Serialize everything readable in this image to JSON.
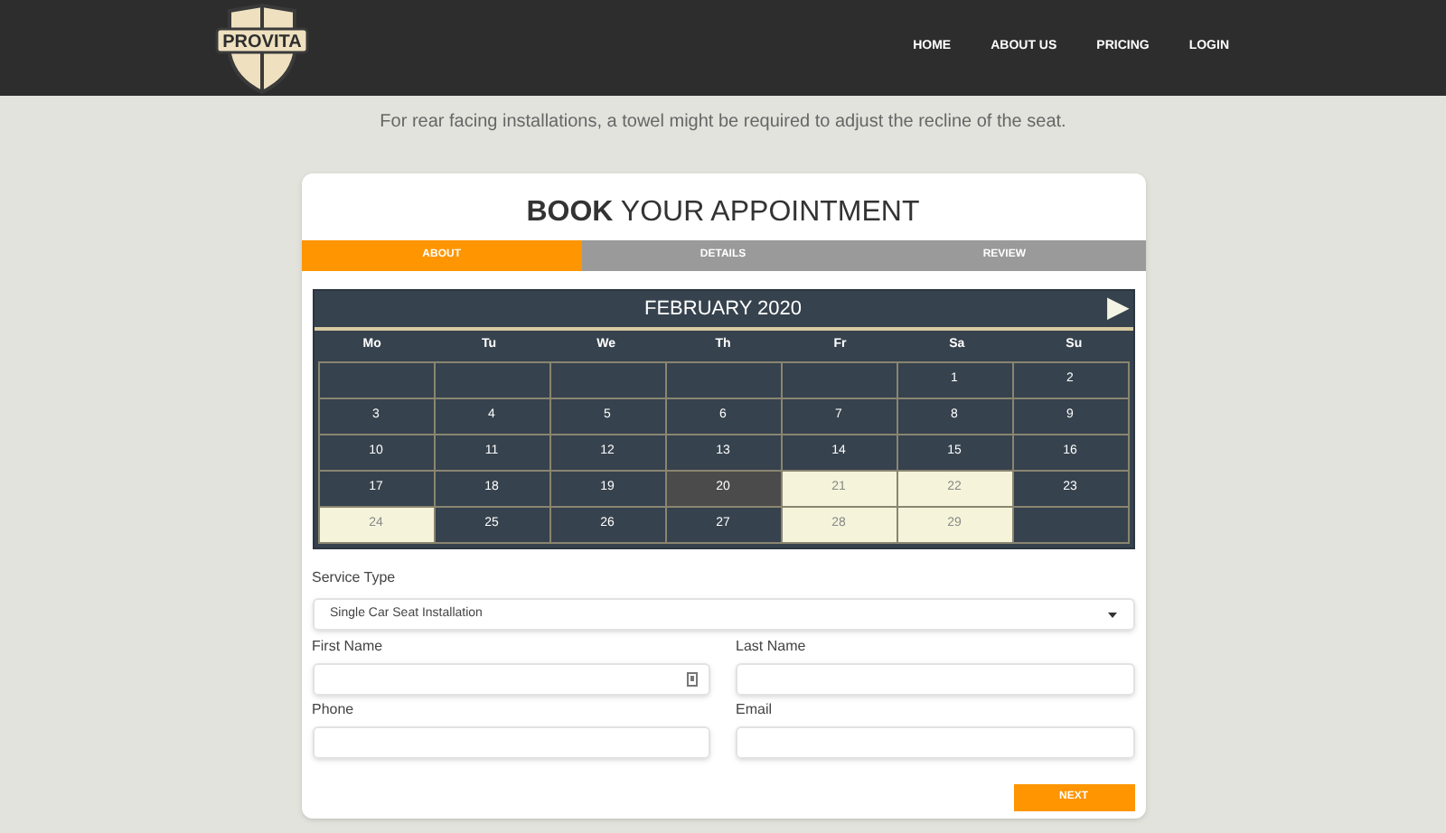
{
  "logo": {
    "text": "PROVITA"
  },
  "nav": [
    {
      "label": "HOME"
    },
    {
      "label": "ABOUT US"
    },
    {
      "label": "PRICING"
    },
    {
      "label": "LOGIN"
    }
  ],
  "notice": "For rear facing installations, a towel might be required to adjust the recline of the seat.",
  "title": "**BOOK** YOUR APPOINTMENT",
  "steps": [
    {
      "label": "ABOUT",
      "selected": true
    },
    {
      "label": "DETAILS",
      "selected": false
    },
    {
      "label": "REVIEW",
      "selected": false
    }
  ],
  "calendar": {
    "month": "FEBRUARY 2020",
    "next": "▶",
    "weekdays": [
      "Mo",
      "Tu",
      "We",
      "Th",
      "Fr",
      "Sa",
      "Su"
    ],
    "weeks": [
      [
        {
          "kind": "blank"
        },
        {
          "kind": "blank"
        },
        {
          "kind": "blank"
        },
        {
          "kind": "blank"
        },
        {
          "kind": "blank"
        },
        {
          "kind": "day",
          "label": "1"
        },
        {
          "kind": "day",
          "label": "2"
        }
      ],
      [
        {
          "kind": "day",
          "label": "3"
        },
        {
          "kind": "day",
          "label": "4"
        },
        {
          "kind": "day",
          "label": "5"
        },
        {
          "kind": "day",
          "label": "6"
        },
        {
          "kind": "day",
          "label": "7"
        },
        {
          "kind": "day",
          "label": "8"
        },
        {
          "kind": "day",
          "label": "9"
        }
      ],
      [
        {
          "kind": "day",
          "label": "10"
        },
        {
          "kind": "day",
          "label": "11"
        },
        {
          "kind": "day",
          "label": "12"
        },
        {
          "kind": "day",
          "label": "13"
        },
        {
          "kind": "day",
          "label": "14"
        },
        {
          "kind": "day",
          "label": "15"
        },
        {
          "kind": "day",
          "label": "16"
        }
      ],
      [
        {
          "kind": "day",
          "label": "17"
        },
        {
          "kind": "day",
          "label": "18"
        },
        {
          "kind": "day",
          "label": "19"
        },
        {
          "kind": "today",
          "label": "20"
        },
        {
          "kind": "available",
          "label": "21"
        },
        {
          "kind": "available",
          "label": "22"
        },
        {
          "kind": "day",
          "label": "23"
        }
      ],
      [
        {
          "kind": "available",
          "label": "24"
        },
        {
          "kind": "day",
          "label": "25"
        },
        {
          "kind": "day",
          "label": "26"
        },
        {
          "kind": "day",
          "label": "27"
        },
        {
          "kind": "available",
          "label": "28"
        },
        {
          "kind": "available",
          "label": "29"
        },
        {
          "kind": "blank"
        }
      ]
    ]
  },
  "service_type": {
    "label": "Service Type",
    "value": "Single Car Seat Installation"
  },
  "fields": [
    {
      "label": "First Name",
      "contact_icon": true
    },
    {
      "label": "Last Name",
      "contact_icon": false
    },
    {
      "label": "Phone",
      "contact_icon": false
    },
    {
      "label": "Email",
      "contact_icon": false
    }
  ],
  "next_button": "NEXT"
}
